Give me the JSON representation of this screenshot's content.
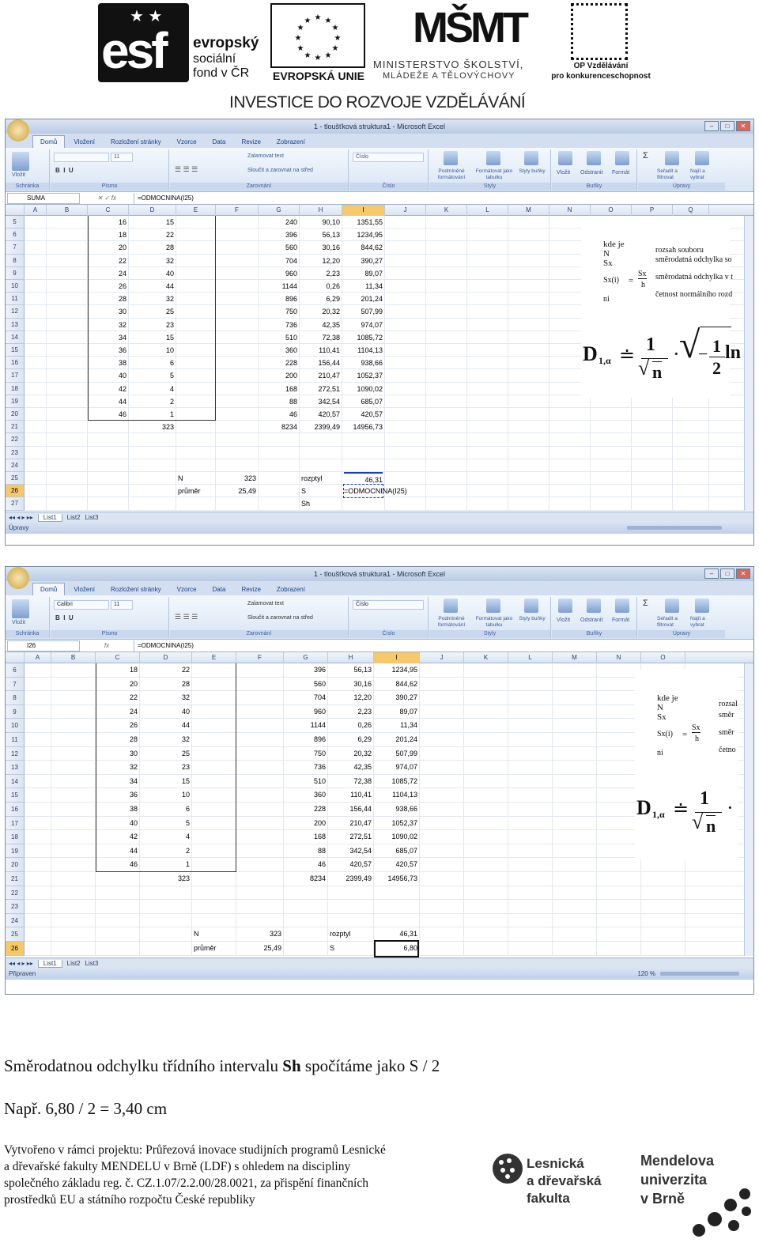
{
  "header": {
    "esf": {
      "big": "esf",
      "line1": "evropský",
      "line2": "sociální",
      "line3": "fond v ČR"
    },
    "eu": {
      "label": "EVROPSKÁ UNIE"
    },
    "msmt": {
      "big": "MŠMT",
      "line1": "MINISTERSTVO ŠKOLSTVÍ,",
      "line2": "MLÁDEŽE A TĚLOVÝCHOVY"
    },
    "op": {
      "line1": "OP Vzdělávání",
      "line2": "pro konkurenceschopnost"
    },
    "slogan": "INVESTICE DO ROZVOJE VZDĚLÁVÁNÍ"
  },
  "excel": {
    "title": "1 - tloušťková struktura1 - Microsoft Excel",
    "tabs": [
      "Domů",
      "Vložení",
      "Rozložení stránky",
      "Vzorce",
      "Data",
      "Revize",
      "Zobrazení"
    ],
    "groups": [
      "Schránka",
      "Písmo",
      "Zarovnání",
      "Číslo",
      "Styly",
      "Buňky",
      "Úpravy"
    ],
    "buttons": {
      "paste": "Vložit",
      "wrap": "Zalamovat text",
      "merge": "Sloučit a zarovnat na střed",
      "number_format": "Číslo",
      "cond_format": "Podmíněné formátování",
      "format_table": "Formátovat jako tabulku",
      "cell_styles": "Styly buňky",
      "insert": "Vložit",
      "delete": "Odstranit",
      "format": "Formát",
      "sort": "Seřadit a filtrovat",
      "find": "Najít a vybrat"
    },
    "sheet_tabs": [
      "List1",
      "List2",
      "List3"
    ],
    "col_letters_a": [
      "A",
      "B",
      "C",
      "D",
      "E",
      "F",
      "G",
      "H",
      "I",
      "J",
      "K",
      "L",
      "M",
      "N",
      "O",
      "P",
      "Q"
    ],
    "col_letters_b": [
      "A",
      "B",
      "C",
      "D",
      "E",
      "F",
      "G",
      "H",
      "I",
      "J",
      "K",
      "L",
      "M",
      "N",
      "O"
    ]
  },
  "shot1": {
    "namebox": "SUMA",
    "formula": "=ODMOCNINA(I25)",
    "font": "",
    "size": "11",
    "zoom": "",
    "status": "Úpravy",
    "rows": [
      {
        "n": "5",
        "c": "16",
        "d": "15",
        "g": "240",
        "h": "90,10",
        "i": "1351,55"
      },
      {
        "n": "6",
        "c": "18",
        "d": "22",
        "g": "396",
        "h": "56,13",
        "i": "1234,95"
      },
      {
        "n": "7",
        "c": "20",
        "d": "28",
        "g": "560",
        "h": "30,16",
        "i": "844,62"
      },
      {
        "n": "8",
        "c": "22",
        "d": "32",
        "g": "704",
        "h": "12,20",
        "i": "390,27"
      },
      {
        "n": "9",
        "c": "24",
        "d": "40",
        "g": "960",
        "h": "2,23",
        "i": "89,07"
      },
      {
        "n": "10",
        "c": "26",
        "d": "44",
        "g": "1144",
        "h": "0,26",
        "i": "11,34"
      },
      {
        "n": "11",
        "c": "28",
        "d": "32",
        "g": "896",
        "h": "6,29",
        "i": "201,24"
      },
      {
        "n": "12",
        "c": "30",
        "d": "25",
        "g": "750",
        "h": "20,32",
        "i": "507,99"
      },
      {
        "n": "13",
        "c": "32",
        "d": "23",
        "g": "736",
        "h": "42,35",
        "i": "974,07"
      },
      {
        "n": "14",
        "c": "34",
        "d": "15",
        "g": "510",
        "h": "72,38",
        "i": "1085,72"
      },
      {
        "n": "15",
        "c": "36",
        "d": "10",
        "g": "360",
        "h": "110,41",
        "i": "1104,13"
      },
      {
        "n": "16",
        "c": "38",
        "d": "6",
        "g": "228",
        "h": "156,44",
        "i": "938,66"
      },
      {
        "n": "17",
        "c": "40",
        "d": "5",
        "g": "200",
        "h": "210,47",
        "i": "1052,37"
      },
      {
        "n": "18",
        "c": "42",
        "d": "4",
        "g": "168",
        "h": "272,51",
        "i": "1090,02"
      },
      {
        "n": "19",
        "c": "44",
        "d": "2",
        "g": "88",
        "h": "342,54",
        "i": "685,07"
      },
      {
        "n": "20",
        "c": "46",
        "d": "1",
        "g": "46",
        "h": "420,57",
        "i": "420,57"
      },
      {
        "n": "21",
        "c": "",
        "d": "323",
        "g": "8234",
        "h": "2399,49",
        "i": "14956,73"
      },
      {
        "n": "22",
        "c": "",
        "d": "",
        "g": "",
        "h": "",
        "i": ""
      },
      {
        "n": "23",
        "c": "",
        "d": "",
        "g": "",
        "h": "",
        "i": ""
      },
      {
        "n": "24",
        "c": "",
        "d": "",
        "g": "",
        "h": "",
        "i": ""
      },
      {
        "n": "25",
        "c": "",
        "d": "",
        "g": "",
        "h": "",
        "i": "46,31"
      },
      {
        "n": "26",
        "c": "",
        "d": "",
        "g": "",
        "h": "",
        "i": "=ODMOCNINA(I25)"
      },
      {
        "n": "27",
        "c": "",
        "d": "",
        "g": "",
        "h": "",
        "i": ""
      }
    ],
    "extra": {
      "n_label": "N",
      "n_val": "323",
      "mean_label": "průměr",
      "mean_val": "25,49",
      "var_label": "rozptyl",
      "s_label": "S",
      "sh_label": "Sh"
    }
  },
  "shot2": {
    "namebox": "I26",
    "formula": "=ODMOCNINA(I25)",
    "font": "Calibri",
    "size": "11",
    "zoom": "120 %",
    "status": "Připraven",
    "rows": [
      {
        "n": "6",
        "c": "18",
        "d": "22",
        "g": "396",
        "h": "56,13",
        "i": "1234,95"
      },
      {
        "n": "7",
        "c": "20",
        "d": "28",
        "g": "560",
        "h": "30,16",
        "i": "844,62"
      },
      {
        "n": "8",
        "c": "22",
        "d": "32",
        "g": "704",
        "h": "12,20",
        "i": "390,27"
      },
      {
        "n": "9",
        "c": "24",
        "d": "40",
        "g": "960",
        "h": "2,23",
        "i": "89,07"
      },
      {
        "n": "10",
        "c": "26",
        "d": "44",
        "g": "1144",
        "h": "0,26",
        "i": "11,34"
      },
      {
        "n": "11",
        "c": "28",
        "d": "32",
        "g": "896",
        "h": "6,29",
        "i": "201,24"
      },
      {
        "n": "12",
        "c": "30",
        "d": "25",
        "g": "750",
        "h": "20,32",
        "i": "507,99"
      },
      {
        "n": "13",
        "c": "32",
        "d": "23",
        "g": "736",
        "h": "42,35",
        "i": "974,07"
      },
      {
        "n": "14",
        "c": "34",
        "d": "15",
        "g": "510",
        "h": "72,38",
        "i": "1085,72"
      },
      {
        "n": "15",
        "c": "36",
        "d": "10",
        "g": "360",
        "h": "110,41",
        "i": "1104,13"
      },
      {
        "n": "16",
        "c": "38",
        "d": "6",
        "g": "228",
        "h": "156,44",
        "i": "938,66"
      },
      {
        "n": "17",
        "c": "40",
        "d": "5",
        "g": "200",
        "h": "210,47",
        "i": "1052,37"
      },
      {
        "n": "18",
        "c": "42",
        "d": "4",
        "g": "168",
        "h": "272,51",
        "i": "1090,02"
      },
      {
        "n": "19",
        "c": "44",
        "d": "2",
        "g": "88",
        "h": "342,54",
        "i": "685,07"
      },
      {
        "n": "20",
        "c": "46",
        "d": "1",
        "g": "46",
        "h": "420,57",
        "i": "420,57"
      },
      {
        "n": "21",
        "c": "",
        "d": "323",
        "g": "8234",
        "h": "2399,49",
        "i": "14956,73"
      },
      {
        "n": "22",
        "c": "",
        "d": "",
        "g": "",
        "h": "",
        "i": ""
      },
      {
        "n": "23",
        "c": "",
        "d": "",
        "g": "",
        "h": "",
        "i": ""
      },
      {
        "n": "24",
        "c": "",
        "d": "",
        "g": "",
        "h": "",
        "i": ""
      },
      {
        "n": "25",
        "c": "",
        "d": "",
        "g": "",
        "h": "",
        "i": "46,31"
      },
      {
        "n": "26",
        "c": "",
        "d": "",
        "g": "",
        "h": "",
        "i": "6,80"
      }
    ],
    "extra": {
      "n_label": "N",
      "n_val": "323",
      "mean_label": "průměr",
      "mean_val": "25,49",
      "var_label": "rozptyl",
      "s_label": "S"
    }
  },
  "formula_panel": {
    "kde_je": "kde je",
    "N": "N",
    "Sx": "Sx",
    "Sxi": "Sx(i)",
    "eq": "=",
    "frac_num": "Sx",
    "frac_den": "h",
    "ni": "ni",
    "desc1": "rozsah souboru",
    "desc2": "směrodatná odchylka so",
    "desc3": "směrodatná odchylka v t",
    "desc4": "četnost normálního rozd",
    "D": "D",
    "D_sub": "1,α",
    "approx": "≐",
    "one": "1",
    "sqrt_n": "n",
    "half_num": "1",
    "half_den": "2",
    "ln": "ln",
    "desc2b": "směr",
    "desc3b": "směr",
    "desc4b": "četno",
    "desc1b": "rozsal"
  },
  "text": {
    "line1_pre": "Směrodatnou odchylku třídního intervalu ",
    "line1_bold": "Sh",
    "line1_post": " spočítáme jako S / 2",
    "line2": "Např. 6,80 / 2 = 3,40 cm",
    "footer": [
      "Vytvořeno v rámci projektu: Průřezová inovace studijních programů Lesnické",
      "a dřevařské fakulty MENDELU v Brně (LDF) s ohledem na discipliny",
      "společného základu  reg. č. CZ.1.07/2.2.00/28.0021, za přispění finančních",
      "prostředků EU a státního rozpočtu České republiky"
    ],
    "ldf": [
      "Lesnická",
      "a dřevařská",
      "fakulta"
    ],
    "mendelu": [
      "Mendelova",
      "univerzita",
      "v Brně"
    ]
  }
}
